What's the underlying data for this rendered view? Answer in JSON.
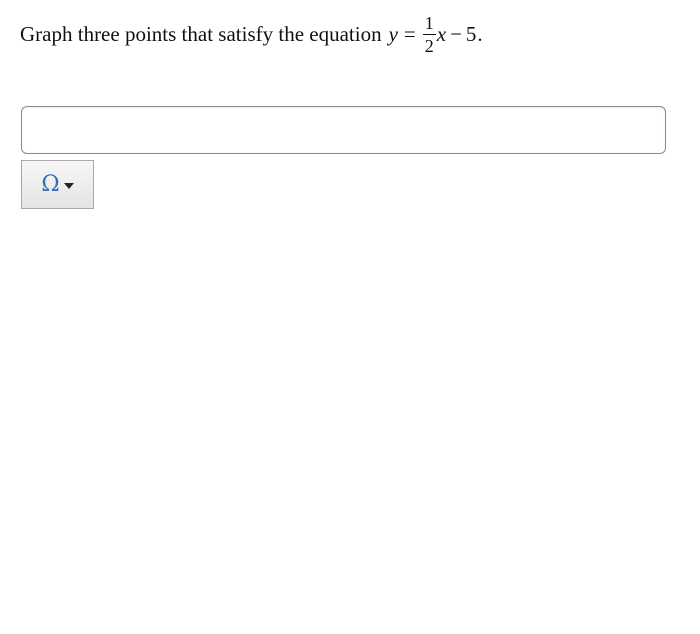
{
  "question": {
    "text": "Graph three points that satisfy the equation",
    "equation": {
      "lhs": "y",
      "equals": "=",
      "numerator": "1",
      "denominator": "2",
      "variable": "x",
      "minus": "−",
      "constant": "5",
      "period": "."
    }
  },
  "answer_input": {
    "value": "",
    "placeholder": ""
  },
  "symbol_button": {
    "glyph": "Ω",
    "icon": "chevron-down-icon",
    "accent": "#2e6fb7"
  }
}
